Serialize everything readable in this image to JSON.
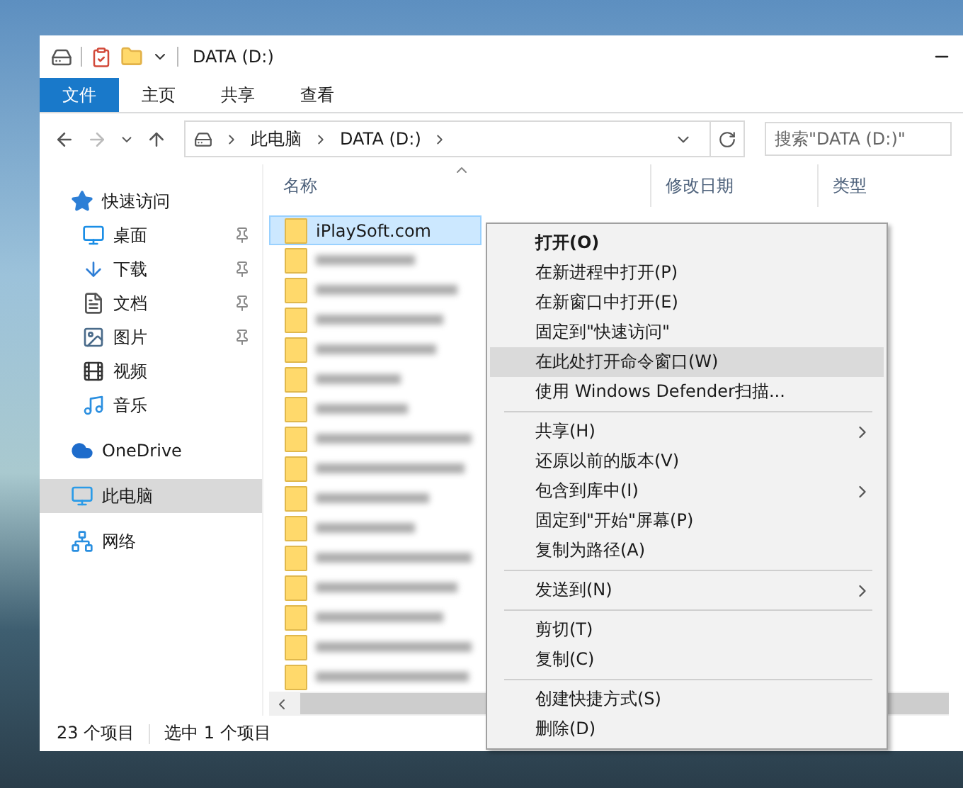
{
  "window": {
    "title": "DATA (D:)"
  },
  "ribbon_tabs": [
    {
      "label": "文件",
      "kind": "file"
    },
    {
      "label": "主页",
      "kind": "tab"
    },
    {
      "label": "共享",
      "kind": "tab"
    },
    {
      "label": "查看",
      "kind": "tab"
    }
  ],
  "address_bar": {
    "crumbs": [
      "此电脑",
      "DATA (D:)"
    ],
    "search": {
      "placeholder": "搜索\"DATA (D:)\""
    }
  },
  "nav_pane": [
    {
      "label": "快速访问",
      "kind": "star",
      "selected": false,
      "children": [
        {
          "label": "桌面",
          "kind": "desktop",
          "pinned": true,
          "selected": false
        },
        {
          "label": "下载",
          "kind": "download",
          "pinned": true,
          "selected": false
        },
        {
          "label": "文档",
          "kind": "document",
          "pinned": true,
          "selected": false
        },
        {
          "label": "图片",
          "kind": "picture",
          "pinned": true,
          "selected": false
        },
        {
          "label": "视频",
          "kind": "video",
          "pinned": false,
          "selected": false
        },
        {
          "label": "音乐",
          "kind": "music",
          "pinned": false,
          "selected": false
        }
      ]
    },
    {
      "label": "OneDrive",
      "kind": "cloud",
      "selected": false
    },
    {
      "label": "此电脑",
      "kind": "computer",
      "selected": true
    },
    {
      "label": "网络",
      "kind": "network",
      "selected": false
    }
  ],
  "file_list": {
    "columns": [
      "名称",
      "修改日期",
      "类型"
    ],
    "rows": [
      {
        "name": "iPlaySoft.com",
        "selected": true
      },
      {
        "selected": false
      },
      {
        "selected": false
      },
      {
        "selected": false
      },
      {
        "selected": false
      },
      {
        "selected": false
      },
      {
        "selected": false
      },
      {
        "selected": false
      },
      {
        "selected": false
      },
      {
        "selected": false
      },
      {
        "selected": false
      },
      {
        "selected": false
      },
      {
        "selected": false
      },
      {
        "selected": false
      },
      {
        "selected": false
      },
      {
        "selected": false
      }
    ]
  },
  "status_bar": {
    "count": "23 个项目",
    "selection": "选中 1 个项目"
  },
  "context_menu": [
    [
      {
        "label": "打开(O)",
        "default": true,
        "submenu": false,
        "selected": false
      },
      {
        "label": "在新进程中打开(P)",
        "default": false,
        "submenu": false,
        "selected": false
      },
      {
        "label": "在新窗口中打开(E)",
        "default": false,
        "submenu": false,
        "selected": false
      },
      {
        "label": "固定到\"快速访问\"",
        "default": false,
        "submenu": false,
        "selected": false
      },
      {
        "label": "在此处打开命令窗口(W)",
        "default": false,
        "submenu": false,
        "selected": true
      },
      {
        "label": "使用 Windows Defender扫描...",
        "default": false,
        "submenu": false,
        "selected": false
      }
    ],
    [
      {
        "label": "共享(H)",
        "default": false,
        "submenu": true,
        "selected": false
      },
      {
        "label": "还原以前的版本(V)",
        "default": false,
        "submenu": false,
        "selected": false
      },
      {
        "label": "包含到库中(I)",
        "default": false,
        "submenu": true,
        "selected": false
      },
      {
        "label": "固定到\"开始\"屏幕(P)",
        "default": false,
        "submenu": false,
        "selected": false
      },
      {
        "label": "复制为路径(A)",
        "default": false,
        "submenu": false,
        "selected": false
      }
    ],
    [
      {
        "label": "发送到(N)",
        "default": false,
        "submenu": true,
        "selected": false
      }
    ],
    [
      {
        "label": "剪切(T)",
        "default": false,
        "submenu": false,
        "selected": false
      },
      {
        "label": "复制(C)",
        "default": false,
        "submenu": false,
        "selected": false
      }
    ],
    [
      {
        "label": "创建快捷方式(S)",
        "default": false,
        "submenu": false,
        "selected": false
      },
      {
        "label": "删除(D)",
        "default": false,
        "submenu": false,
        "selected": false
      }
    ]
  ]
}
